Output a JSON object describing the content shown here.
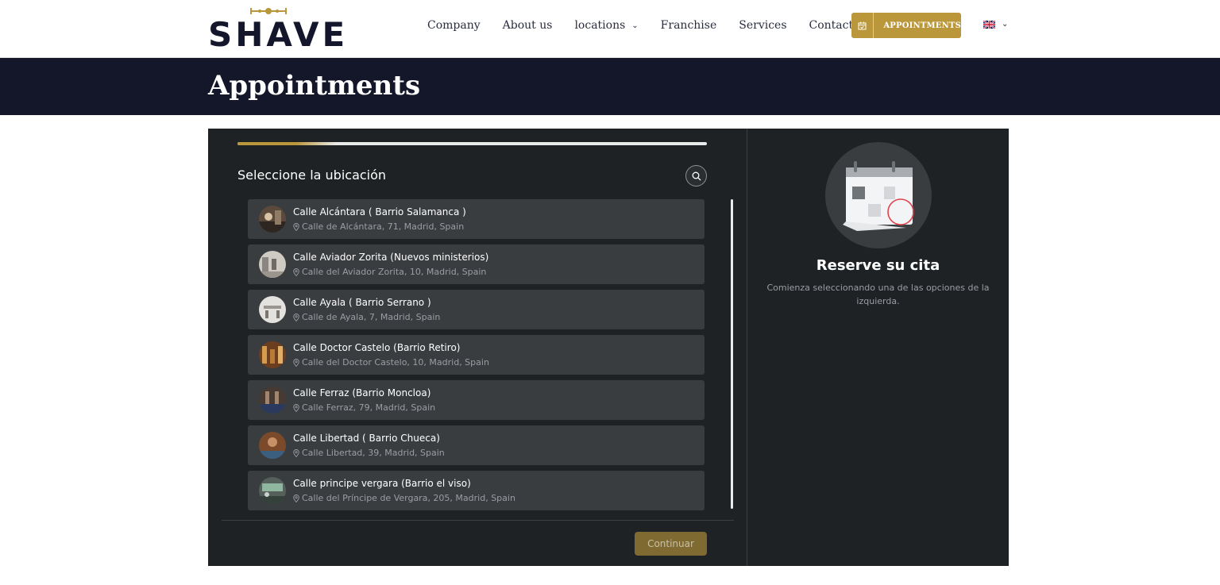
{
  "header": {
    "logo_text": "SHAVE",
    "nav": [
      {
        "label": "Company",
        "has_dropdown": false
      },
      {
        "label": "About us",
        "has_dropdown": false
      },
      {
        "label": "locations",
        "has_dropdown": true
      },
      {
        "label": "Franchise",
        "has_dropdown": false
      },
      {
        "label": "Services",
        "has_dropdown": false
      },
      {
        "label": "Contact us",
        "has_dropdown": false
      }
    ],
    "appointments_button": "APPOINTMENTS",
    "language_icon": "uk-flag-icon"
  },
  "page": {
    "title": "Appointments"
  },
  "booking": {
    "progress_percent": 15,
    "section_title": "Seleccione la ubicación",
    "locations": [
      {
        "name": "Calle Alcántara ( Barrio Salamanca )",
        "address": "Calle de Alcántara, 71, Madrid, Spain"
      },
      {
        "name": "Calle Aviador Zorita (Nuevos ministerios)",
        "address": "Calle del Aviador Zorita, 10, Madrid, Spain"
      },
      {
        "name": "Calle Ayala ( Barrio Serrano )",
        "address": "Calle de Ayala, 7, Madrid, Spain"
      },
      {
        "name": "Calle Doctor Castelo (Barrio Retiro)",
        "address": "Calle del Doctor Castelo, 10, Madrid, Spain"
      },
      {
        "name": "Calle Ferraz (Barrio Moncloa)",
        "address": "Calle Ferraz, 79, Madrid, Spain"
      },
      {
        "name": "Calle Libertad ( Barrio Chueca)",
        "address": "Calle Libertad, 39, Madrid, Spain"
      },
      {
        "name": "Calle principe vergara (Barrio el viso)",
        "address": "Calle del Príncipe de Vergara, 205, Madrid, Spain"
      }
    ],
    "continue_label": "Continuar",
    "summary_title": "Reserve su cita",
    "summary_text": "Comienza seleccionando una de las opciones de la izquierda."
  },
  "colors": {
    "accent": "#b9973a",
    "navy": "#141729",
    "panel": "#1f2224",
    "card": "#3a3d40"
  }
}
